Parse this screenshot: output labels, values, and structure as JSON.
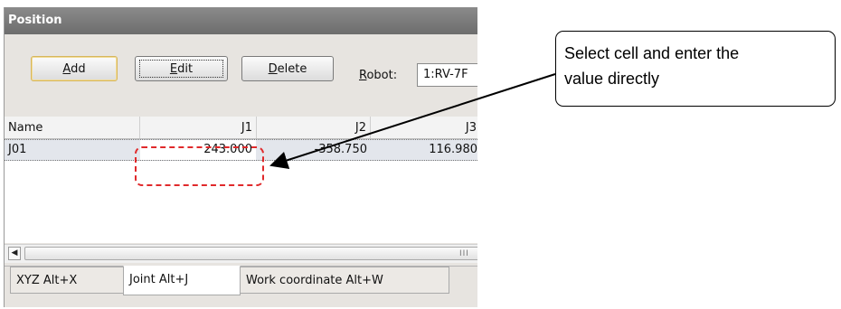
{
  "panel": {
    "title": "Position"
  },
  "toolbar": {
    "add_mnemonic": "A",
    "add_rest": "dd",
    "edit_mnemonic": "E",
    "edit_rest": "dit",
    "delete_mnemonic": "D",
    "delete_rest": "elete",
    "robot_mnemonic": "R",
    "robot_rest": "obot:",
    "robot_value": "1:RV-7F"
  },
  "grid": {
    "columns": [
      "Name",
      "J1",
      "J2",
      "J3"
    ],
    "rows": [
      {
        "name": "J01",
        "j1": "243.000",
        "j2": "-358.750",
        "j3": "116.980"
      }
    ]
  },
  "scrollbar": {
    "grip": "III"
  },
  "tabs": [
    {
      "label": "XYZ   Alt+X",
      "active": false
    },
    {
      "label": "Joint   Alt+J",
      "active": true
    },
    {
      "label": "Work coordinate   Alt+W",
      "active": false
    }
  ],
  "annotation": {
    "line1": "Select cell and enter the",
    "line2": "value directly",
    "highlight_color": "#e0292b"
  },
  "icons": {
    "scroll_left": "triangle-left"
  }
}
